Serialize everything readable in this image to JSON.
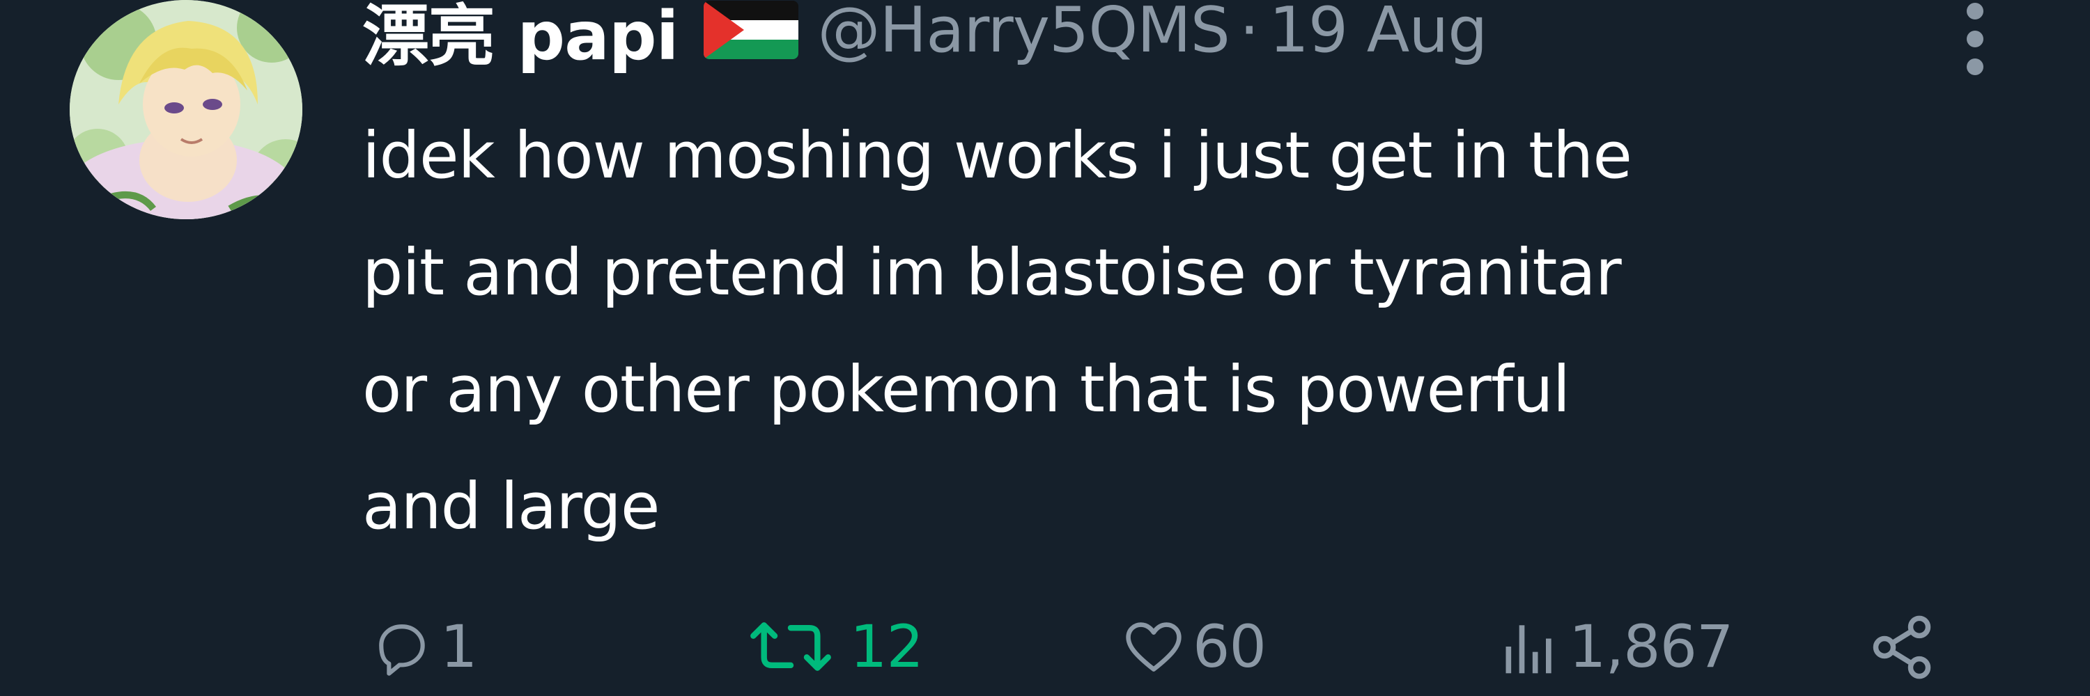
{
  "tweet": {
    "author": {
      "display_name": "漂亮 papi",
      "flag_icon": "palestine-flag-icon",
      "handle": "@Harry5QMS"
    },
    "separator": "·",
    "timestamp": "19 Aug",
    "text": "idek how moshing works i just get in the\npit and pretend im blastoise or tyranitar\nor any other pokemon that is powerful\nand large",
    "actions": {
      "replies": "1",
      "retweets": "12",
      "likes": "60",
      "views": "1,867"
    },
    "icons": {
      "more": "more-vertical-icon",
      "reply": "reply-bubble-icon",
      "retweet": "retweet-icon",
      "like": "heart-icon",
      "views": "views-chart-icon",
      "share": "share-icon"
    },
    "colors": {
      "background": "#15202b",
      "text": "#ffffff",
      "muted": "#8b98a5",
      "retweet_active": "#00ba7c"
    }
  }
}
